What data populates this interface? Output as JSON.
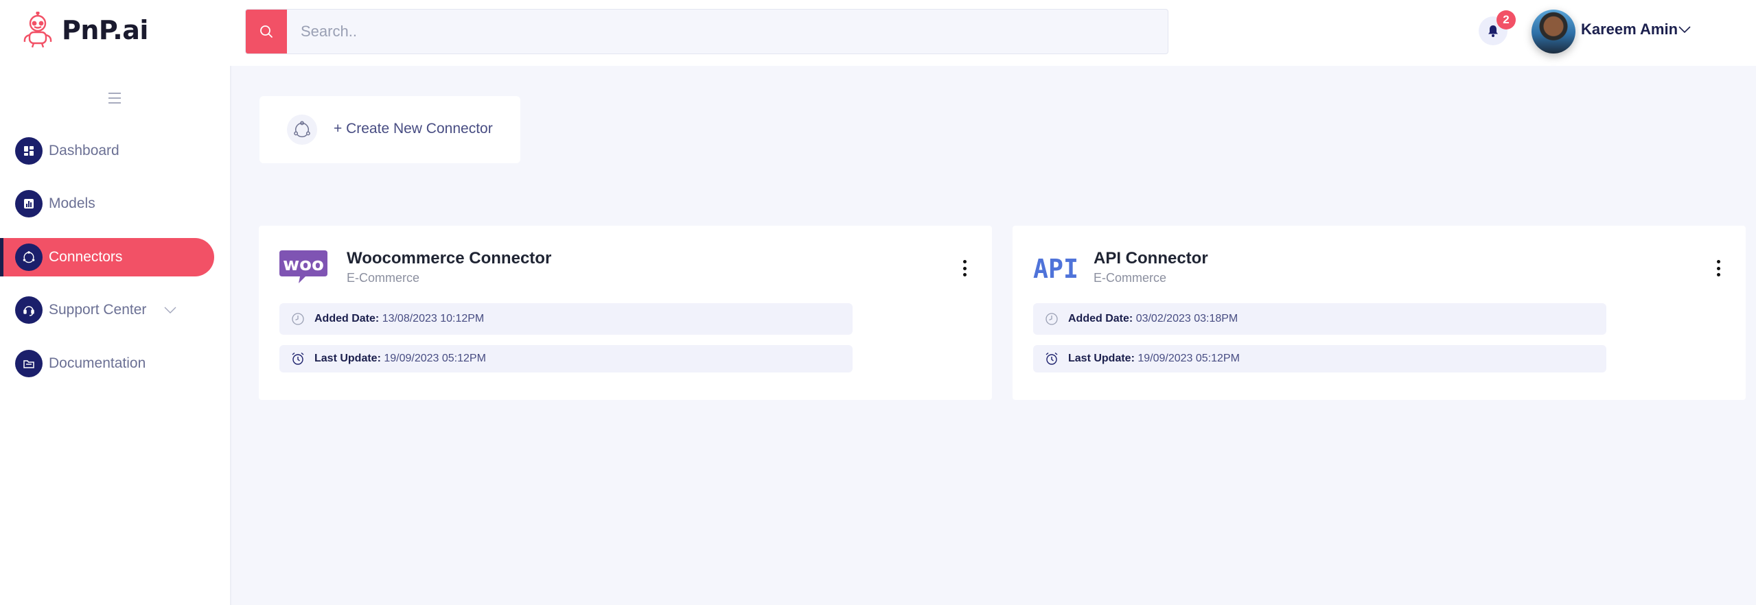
{
  "brand": {
    "name": "PnP.ai"
  },
  "search": {
    "placeholder": "Search.."
  },
  "notifications": {
    "count": "2"
  },
  "user": {
    "name": "Kareem Amin"
  },
  "sidebar": {
    "items": [
      {
        "label": "Dashboard",
        "icon": "dashboard-icon"
      },
      {
        "label": "Models",
        "icon": "chart-icon"
      },
      {
        "label": "Connectors",
        "icon": "connectors-icon",
        "active": true
      },
      {
        "label": "Support Center",
        "icon": "headset-icon",
        "expandable": true
      },
      {
        "label": "Documentation",
        "icon": "folder-icon"
      }
    ]
  },
  "create": {
    "label": "+ Create New Connector"
  },
  "connectors": [
    {
      "title": "Woocommerce Connector",
      "category": "E-Commerce",
      "logo": "woo-logo",
      "added_label": "Added Date:",
      "added_value": "13/08/2023 10:12PM",
      "update_label": "Last Update:",
      "update_value": "19/09/2023 05:12PM"
    },
    {
      "title": "API Connector",
      "category": "E-Commerce",
      "logo": "api-logo",
      "added_label": "Added Date:",
      "added_value": "03/02/2023 03:18PM",
      "update_label": "Last Update:",
      "update_value": "19/09/2023 05:12PM"
    }
  ],
  "colors": {
    "accent": "#f25166",
    "navy": "#1b1f6b",
    "background": "#f5f6fc",
    "woo": "#7f54b3",
    "api": "#4f73d9"
  }
}
